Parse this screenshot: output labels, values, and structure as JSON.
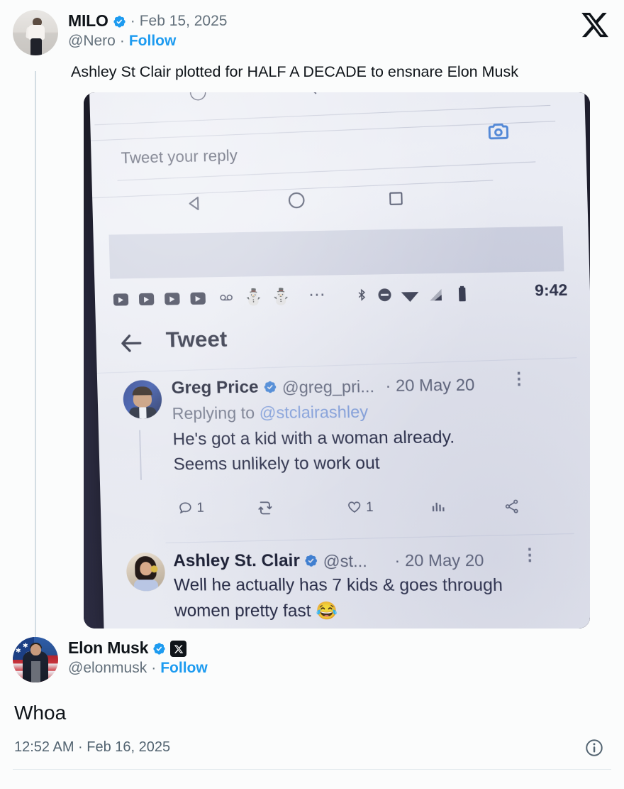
{
  "quoted_tweet": {
    "author": {
      "display_name": "MILO",
      "handle": "@Nero",
      "verified": true,
      "avatar_alt": "milo-avatar"
    },
    "separator": "·",
    "date": "Feb 15, 2025",
    "follow_label": "Follow",
    "body": "Ashley St Clair plotted for HALF A DECADE to ensnare Elon Musk",
    "corner_logo": "x-logo"
  },
  "photo": {
    "alt": "photo-of-phone-showing-twitter-thread",
    "phone_screen": {
      "reply_placeholder": "Tweet your reply",
      "camera_icon": "camera-icon",
      "nav_bar": {
        "back": "triangle-back-icon",
        "home": "circle-home-icon",
        "recents": "square-recents-icon"
      },
      "status_bar": {
        "time": "9:42",
        "icons": [
          "youtube-icon",
          "youtube-icon",
          "youtube-icon",
          "youtube-icon",
          "voicemail-icon",
          "gmail-icon",
          "gmail-icon",
          "more-icon",
          "bluetooth-icon",
          "do-not-disturb-icon",
          "wifi-icon",
          "cellular-signal-icon",
          "battery-icon"
        ]
      },
      "header": {
        "back_arrow": "back-arrow-icon",
        "title": "Tweet"
      },
      "tweets": [
        {
          "display_name": "Greg Price",
          "verified": true,
          "handle": "@greg_pri...",
          "separator": "·",
          "date": "20 May 20",
          "replying_to_label": "Replying to",
          "replying_to_handle": "@stclairashley",
          "body_lines": [
            "He's got a kid with a woman already.",
            "Seems unlikely to work out"
          ],
          "actions": {
            "reply_count": "1",
            "retweet_count": "",
            "like_count": "1",
            "views_icon": "analytics-icon",
            "share_icon": "share-icon"
          },
          "overflow_icon": "kebab-menu-icon"
        },
        {
          "display_name": "Ashley St. Clair",
          "verified": true,
          "handle": "@st...",
          "separator": "·",
          "date": "20 May 20",
          "body_lines": [
            "Well he actually has 7 kids & goes through",
            "women pretty fast 😂"
          ],
          "overflow_icon": "kebab-menu-icon"
        }
      ]
    }
  },
  "main_tweet": {
    "author": {
      "display_name": "Elon Musk",
      "handle": "@elonmusk",
      "verified": true,
      "affiliate_badge": "x-badge",
      "avatar_alt": "elon-musk-avatar"
    },
    "separator": "·",
    "follow_label": "Follow",
    "body": "Whoa",
    "timestamp": "12:52 AM · Feb 16, 2025",
    "info_icon": "info-circle-icon"
  },
  "colors": {
    "accent_blue": "#1d9bf0",
    "verified_blue": "#1d9bf0",
    "text_primary": "#0f1419",
    "text_secondary": "#536471",
    "background": "#fbfcfc",
    "bezel_dark": "#26263a"
  }
}
